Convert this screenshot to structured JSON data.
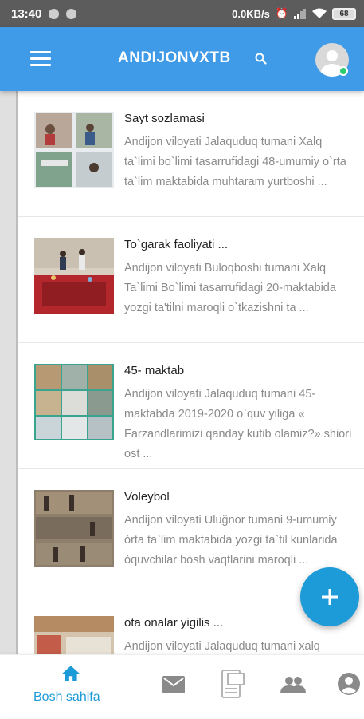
{
  "status_bar": {
    "time": "13:40",
    "network_speed": "0.0KB/s",
    "battery": "68"
  },
  "app_bar": {
    "title": "ANDIJONVXTB",
    "menu_icon": "hamburger-menu-icon",
    "search_icon": "search-icon",
    "avatar_icon": "user-avatar-icon"
  },
  "articles": [
    {
      "title": "Sayt sozlamasi",
      "description": "Andijon viloyati Jalaquduq tumani Xalq ta`limi bo`limi tasarrufidagi 48-umumiy o`rta ta`lim maktabida muhtaram yurtboshi ..."
    },
    {
      "title": "To`garak faoliyati ...",
      "description": "Andijon viloyati Buloqboshi tumani Xalq Ta`limi Bo`limi tasarrufidagi 20-maktabida yozgi ta'tilni maroqli o`tkazishni ta ..."
    },
    {
      "title": "45- maktab",
      "description": "Andijon viloyati Jalaquduq tumani 45-maktabda 2019-2020 o`quv yiliga « Farzandlarimizi qanday kutib olamiz?» shiori ost ..."
    },
    {
      "title": "Voleybol",
      "description": "Andijon viloyati Uluğnor tumani 9-umumiy òrta ta`lim maktabida yozgi ta`til kunlarida òquvchilar bòsh vaqtlarini maroqli ..."
    },
    {
      "title": "ota onalar yigilis ...",
      "description": "Andijon viloyati Jalaquduq tumani xalq"
    }
  ],
  "fab": {
    "icon": "plus-icon"
  },
  "bottom_nav": {
    "home_label": "Bosh sahifa",
    "active_color": "#1d9bd8",
    "icons": [
      "home-icon",
      "mail-icon",
      "document-icon",
      "group-icon",
      "account-icon"
    ]
  },
  "colors": {
    "app_bar": "#3f9be8",
    "accent": "#1d9bd8",
    "status_bar": "#5c5c5c"
  }
}
